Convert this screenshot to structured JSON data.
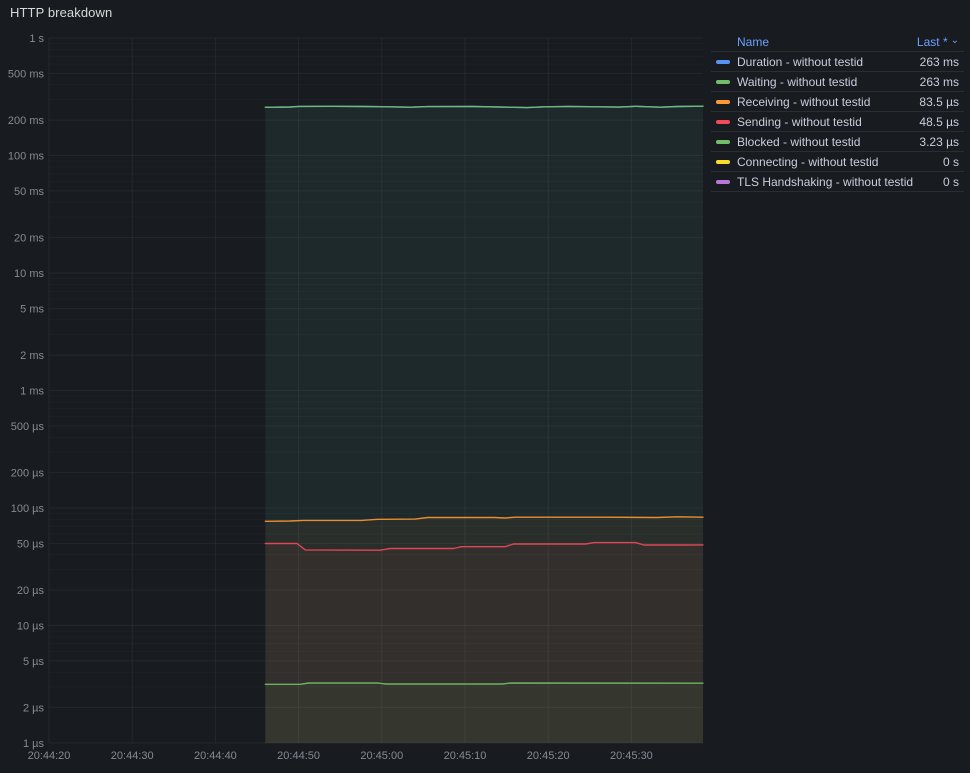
{
  "panel": {
    "title": "HTTP breakdown"
  },
  "colors": {
    "background": "#181b1f",
    "text": "#ccccdc",
    "header_link": "#6e9fff",
    "blue": "#5794f2",
    "green": "#73bf69",
    "orange": "#ff9830",
    "red": "#f2495c",
    "yellow": "#fade2a",
    "purple": "#b877d9"
  },
  "legend": {
    "name_header": "Name",
    "last_header": "Last *",
    "sort_caret": "⌄",
    "rows": [
      {
        "label": "Duration - without testid",
        "value": "263 ms",
        "color": "#5794f2"
      },
      {
        "label": "Waiting - without testid",
        "value": "263 ms",
        "color": "#73bf69"
      },
      {
        "label": "Receiving - without testid",
        "value": "83.5 µs",
        "color": "#ff9830"
      },
      {
        "label": "Sending - without testid",
        "value": "48.5 µs",
        "color": "#f2495c"
      },
      {
        "label": "Blocked - without testid",
        "value": "3.23 µs",
        "color": "#73bf69"
      },
      {
        "label": "Connecting - without testid",
        "value": "0 s",
        "color": "#fade2a"
      },
      {
        "label": "TLS Handshaking - without testid",
        "value": "0 s",
        "color": "#b877d9"
      }
    ]
  },
  "chart_data": {
    "type": "line",
    "title": "HTTP breakdown",
    "x_axis": {
      "unit": "seconds after 20:44:20",
      "min": 0,
      "max": 78.6,
      "ticks": [
        {
          "t": 0,
          "label": "20:44:20"
        },
        {
          "t": 10,
          "label": "20:44:30"
        },
        {
          "t": 20,
          "label": "20:44:40"
        },
        {
          "t": 30,
          "label": "20:44:50"
        },
        {
          "t": 40,
          "label": "20:45:00"
        },
        {
          "t": 50,
          "label": "20:45:10"
        },
        {
          "t": 60,
          "label": "20:45:20"
        },
        {
          "t": 70,
          "label": "20:45:30"
        }
      ]
    },
    "y_axis": {
      "scale": "log",
      "unit": "µs",
      "min": 1,
      "max": 1000000,
      "ticks": [
        {
          "v": 1000000,
          "label": "1 s"
        },
        {
          "v": 500000,
          "label": "500 ms"
        },
        {
          "v": 200000,
          "label": "200 ms"
        },
        {
          "v": 100000,
          "label": "100 ms"
        },
        {
          "v": 50000,
          "label": "50 ms"
        },
        {
          "v": 20000,
          "label": "20 ms"
        },
        {
          "v": 10000,
          "label": "10 ms"
        },
        {
          "v": 5000,
          "label": "5 ms"
        },
        {
          "v": 2000,
          "label": "2 ms"
        },
        {
          "v": 1000,
          "label": "1 ms"
        },
        {
          "v": 500,
          "label": "500 µs"
        },
        {
          "v": 200,
          "label": "200 µs"
        },
        {
          "v": 100,
          "label": "100 µs"
        },
        {
          "v": 50,
          "label": "50 µs"
        },
        {
          "v": 20,
          "label": "20 µs"
        },
        {
          "v": 10,
          "label": "10 µs"
        },
        {
          "v": 5,
          "label": "5 µs"
        },
        {
          "v": 2,
          "label": "2 µs"
        },
        {
          "v": 1,
          "label": "1 µs"
        }
      ],
      "minor_mantissas": [
        3,
        4,
        6,
        7,
        8,
        9
      ]
    },
    "fill_opacity": 0.05,
    "series": [
      {
        "name": "Duration - without testid",
        "color": "#5794f2",
        "last": "263 ms",
        "points": [
          [
            26,
            257000
          ],
          [
            29,
            258500
          ],
          [
            30,
            261500
          ],
          [
            34,
            262000
          ],
          [
            38,
            261000
          ],
          [
            40,
            260000
          ],
          [
            43.5,
            257800
          ],
          [
            45.5,
            260500
          ],
          [
            51,
            261200
          ],
          [
            57.5,
            255500
          ],
          [
            59.5,
            259500
          ],
          [
            62.5,
            261500
          ],
          [
            68.5,
            258000
          ],
          [
            70.5,
            262000
          ],
          [
            73.5,
            257500
          ],
          [
            75.5,
            261000
          ],
          [
            78.6,
            263000
          ]
        ]
      },
      {
        "name": "Waiting - without testid",
        "color": "#73bf69",
        "last": "263 ms",
        "points": [
          [
            26,
            257000
          ],
          [
            29,
            258500
          ],
          [
            30,
            261500
          ],
          [
            34,
            262000
          ],
          [
            38,
            261000
          ],
          [
            40,
            260000
          ],
          [
            43.5,
            257800
          ],
          [
            45.5,
            260500
          ],
          [
            51,
            261200
          ],
          [
            57.5,
            255500
          ],
          [
            59.5,
            259500
          ],
          [
            62.5,
            261500
          ],
          [
            68.5,
            258000
          ],
          [
            70.5,
            262000
          ],
          [
            73.5,
            257500
          ],
          [
            75.5,
            261000
          ],
          [
            78.6,
            263000
          ]
        ]
      },
      {
        "name": "Receiving - without testid",
        "color": "#ff9830",
        "last": "83.5 µs",
        "points": [
          [
            26,
            77
          ],
          [
            29,
            77.5
          ],
          [
            30.5,
            78.5
          ],
          [
            37.5,
            78.5
          ],
          [
            39.5,
            80.2
          ],
          [
            44,
            80.5
          ],
          [
            45.5,
            83
          ],
          [
            53.5,
            83
          ],
          [
            54.8,
            82.2
          ],
          [
            56,
            83.5
          ],
          [
            67,
            83.5
          ],
          [
            73,
            83
          ],
          [
            75.5,
            84.2
          ],
          [
            78.6,
            83.5
          ]
        ]
      },
      {
        "name": "Sending - without testid",
        "color": "#f2495c",
        "last": "48.5 µs",
        "points": [
          [
            26,
            49.9
          ],
          [
            29.8,
            49.9
          ],
          [
            30.8,
            44
          ],
          [
            39.8,
            43.7
          ],
          [
            41,
            45.2
          ],
          [
            48.6,
            45.2
          ],
          [
            49.6,
            46.8
          ],
          [
            54.8,
            46.8
          ],
          [
            55.8,
            49.4
          ],
          [
            64.5,
            49.4
          ],
          [
            65.5,
            50.8
          ],
          [
            70.5,
            50.8
          ],
          [
            71.5,
            48.4
          ],
          [
            77,
            48.4
          ],
          [
            78.6,
            48.5
          ]
        ]
      },
      {
        "name": "Blocked - without testid",
        "color": "#73bf69",
        "last": "3.23 µs",
        "points": [
          [
            26,
            3.16
          ],
          [
            30.2,
            3.16
          ],
          [
            31.2,
            3.24
          ],
          [
            39.5,
            3.24
          ],
          [
            40.5,
            3.18
          ],
          [
            54.5,
            3.18
          ],
          [
            55.5,
            3.24
          ],
          [
            78.6,
            3.23
          ]
        ]
      },
      {
        "name": "Connecting - without testid",
        "color": "#fade2a",
        "last": "0 s",
        "points": []
      },
      {
        "name": "TLS Handshaking - without testid",
        "color": "#b877d9",
        "last": "0 s",
        "points": []
      }
    ]
  }
}
